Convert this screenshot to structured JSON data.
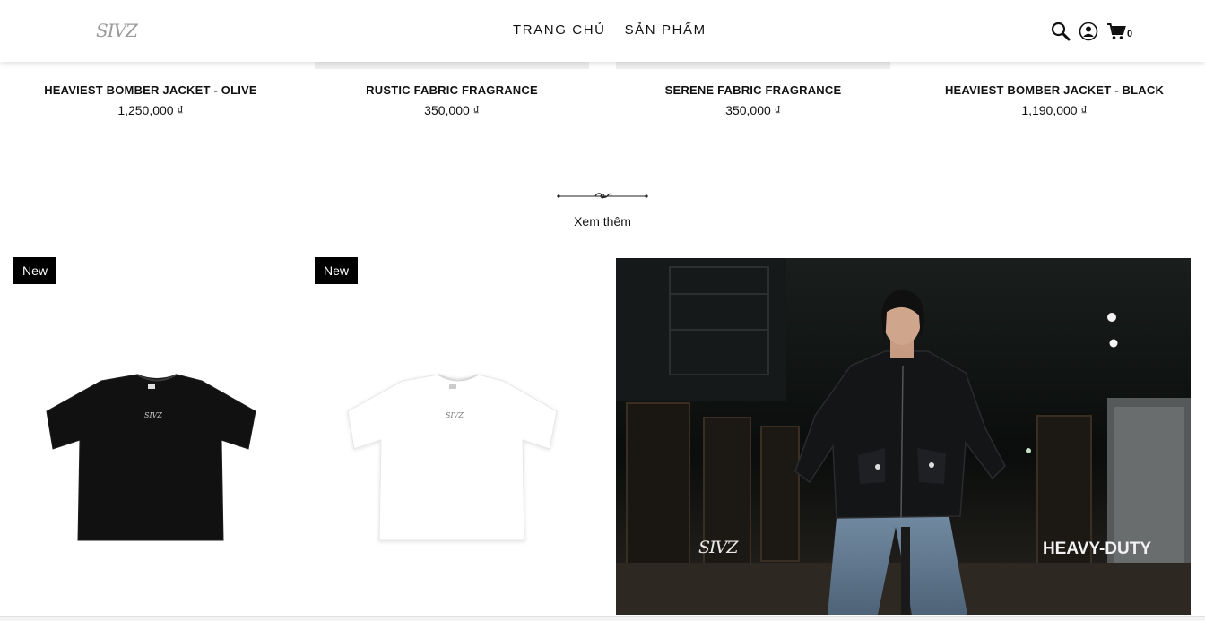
{
  "header": {
    "logo_text": "SIVZ",
    "nav": [
      "TRANG CHỦ",
      "SẢN PHẨM"
    ],
    "cart_count": "0"
  },
  "top_products": [
    {
      "name": "HEAVIEST BOMBER JACKET - OLIVE",
      "price": "1,250,000 ₫"
    },
    {
      "name": "RUSTIC FABRIC FRAGRANCE",
      "price": "350,000 ₫"
    },
    {
      "name": "SERENE FABRIC FRAGRANCE",
      "price": "350,000 ₫"
    },
    {
      "name": "HEAVIEST BOMBER JACKET - BLACK",
      "price": "1,190,000 ₫"
    }
  ],
  "see_more": "Xem thêm",
  "cards": [
    {
      "badge": "New",
      "color": "#111111",
      "logo": "SIVZ"
    },
    {
      "badge": "New",
      "color": "#ffffff",
      "logo": "SIVZ"
    }
  ],
  "banner": {
    "logo": "SIVZ",
    "tagline": "HEAVY-DUTY"
  },
  "icons": [
    "search-icon",
    "user-icon",
    "cart-icon"
  ]
}
